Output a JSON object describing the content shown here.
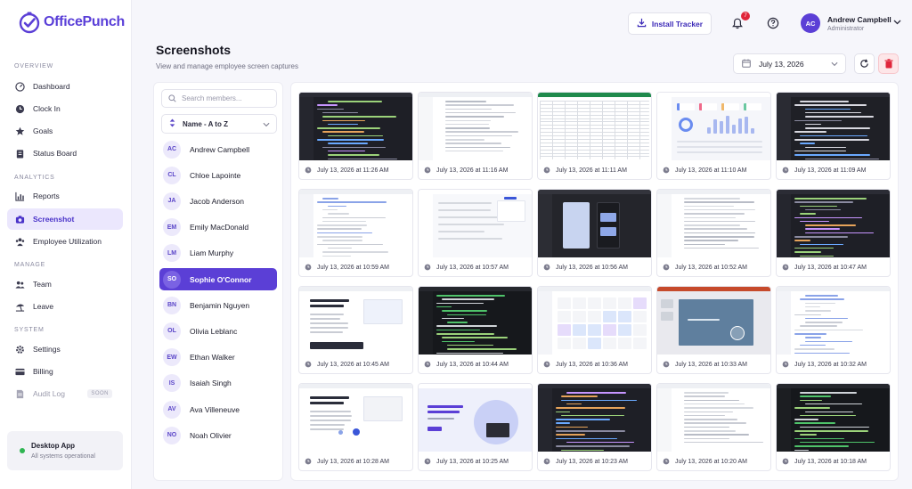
{
  "app": {
    "brand": "OfficePunch",
    "brand_color": "#5b3fd6"
  },
  "sidebar": {
    "sections": [
      {
        "label": "OVERVIEW"
      },
      {
        "label": "ANALYTICS"
      },
      {
        "label": "MANAGE"
      },
      {
        "label": "SYSTEM"
      }
    ],
    "items": [
      {
        "label": "Dashboard",
        "icon": "dashboard-icon"
      },
      {
        "label": "Clock In",
        "icon": "clock-icon"
      },
      {
        "label": "Goals",
        "icon": "star-icon"
      },
      {
        "label": "Status Board",
        "icon": "clipboard-icon"
      },
      {
        "label": "Reports",
        "icon": "bar-chart-icon"
      },
      {
        "label": "Screenshot",
        "icon": "camera-icon",
        "active": true
      },
      {
        "label": "Employee Utilization",
        "icon": "users-icon"
      },
      {
        "label": "Team",
        "icon": "team-icon"
      },
      {
        "label": "Leave",
        "icon": "beach-icon"
      },
      {
        "label": "Settings",
        "icon": "gear-icon"
      },
      {
        "label": "Billing",
        "icon": "credit-card-icon"
      },
      {
        "label": "Audit Log",
        "icon": "document-icon",
        "disabled": true,
        "badge": "SOON"
      }
    ],
    "desktop_app": {
      "title": "Desktop App",
      "status": "All systems operational",
      "status_color": "#2fb552"
    }
  },
  "header": {
    "install_label": "Install Tracker",
    "notification_count": "7",
    "user": {
      "initials": "AC",
      "name": "Andrew Campbell",
      "role": "Administrator"
    }
  },
  "page": {
    "title": "Screenshots",
    "subtitle": "View and manage employee screen captures",
    "date": "July 13, 2026"
  },
  "members_panel": {
    "search_placeholder": "Search members...",
    "sort_label": "Name - A to Z",
    "members": [
      {
        "initials": "AC",
        "name": "Andrew Campbell"
      },
      {
        "initials": "CL",
        "name": "Chloe Lapointe"
      },
      {
        "initials": "JA",
        "name": "Jacob Anderson"
      },
      {
        "initials": "EM",
        "name": "Emily MacDonald"
      },
      {
        "initials": "LM",
        "name": "Liam Murphy"
      },
      {
        "initials": "SO",
        "name": "Sophie O'Connor",
        "active": true
      },
      {
        "initials": "BN",
        "name": "Benjamin Nguyen"
      },
      {
        "initials": "OL",
        "name": "Olivia Leblanc"
      },
      {
        "initials": "EW",
        "name": "Ethan Walker"
      },
      {
        "initials": "IS",
        "name": "Isaiah Singh"
      },
      {
        "initials": "AV",
        "name": "Ava Villeneuve"
      },
      {
        "initials": "NO",
        "name": "Noah Olivier"
      }
    ]
  },
  "screenshots": [
    {
      "time": "July 13, 2026 at 11:26 AM",
      "theme": "dark-code"
    },
    {
      "time": "July 13, 2026 at 11:16 AM",
      "theme": "light-doc"
    },
    {
      "time": "July 13, 2026 at 11:11 AM",
      "theme": "spreadsheet"
    },
    {
      "time": "July 13, 2026 at 11:10 AM",
      "theme": "light-dashboard"
    },
    {
      "time": "July 13, 2026 at 11:09 AM",
      "theme": "dark-chat"
    },
    {
      "time": "July 13, 2026 at 10:59 AM",
      "theme": "light-list"
    },
    {
      "time": "July 13, 2026 at 10:57 AM",
      "theme": "light-app"
    },
    {
      "time": "July 13, 2026 at 10:56 AM",
      "theme": "dark-design"
    },
    {
      "time": "July 13, 2026 at 10:52 AM",
      "theme": "light-doc"
    },
    {
      "time": "July 13, 2026 at 10:47 AM",
      "theme": "dark-code"
    },
    {
      "time": "July 13, 2026 at 10:45 AM",
      "theme": "light-blog"
    },
    {
      "time": "July 13, 2026 at 10:44 AM",
      "theme": "dark-terminal"
    },
    {
      "time": "July 13, 2026 at 10:36 AM",
      "theme": "light-calendar"
    },
    {
      "time": "July 13, 2026 at 10:33 AM",
      "theme": "slides"
    },
    {
      "time": "July 13, 2026 at 10:32 AM",
      "theme": "light-list"
    },
    {
      "time": "July 13, 2026 at 10:28 AM",
      "theme": "light-page"
    },
    {
      "time": "July 13, 2026 at 10:25 AM",
      "theme": "landing"
    },
    {
      "time": "July 13, 2026 at 10:23 AM",
      "theme": "dark-code"
    },
    {
      "time": "July 13, 2026 at 10:20 AM",
      "theme": "light-doc"
    },
    {
      "time": "July 13, 2026 at 10:18 AM",
      "theme": "dark-terminal"
    }
  ]
}
